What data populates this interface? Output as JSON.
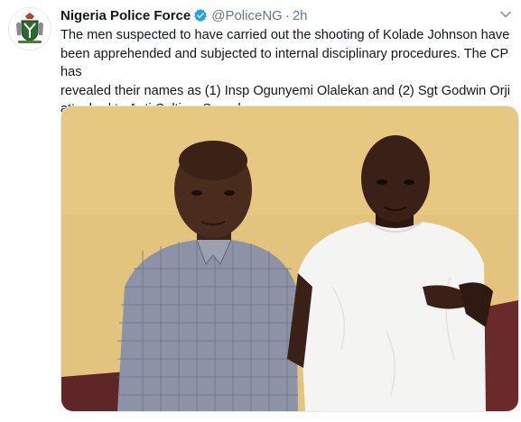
{
  "tweet": {
    "display_name": "Nigeria Police Force",
    "handle": "@PoliceNG",
    "separator": "·",
    "time": "2h",
    "text_lines": [
      "The men suspected to have carried out the shooting of Kolade Johnson have",
      "been apprehended and subjected to internal disciplinary procedures. The CP has",
      "revealed their names as (1) Insp Ogunyemi Olalekan and (2) Sgt Godwin Orji",
      "attached to Anti Cultism Squad"
    ]
  },
  "icons": {
    "verified": "verified-badge-icon",
    "caret": "chevron-down-icon",
    "avatar": "police-crest-logo"
  },
  "colors": {
    "verified_blue": "#1da1f2",
    "muted_text": "#657786",
    "wall_yellow": "#e8c87a",
    "wall_maroon": "#6b2b2b"
  }
}
